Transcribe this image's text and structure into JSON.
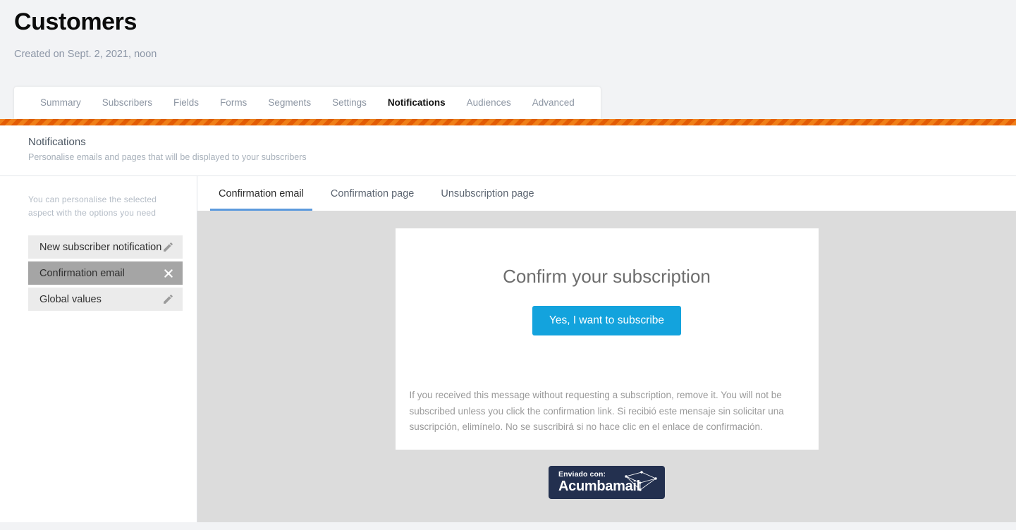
{
  "page": {
    "title": "Customers",
    "created": "Created on Sept. 2, 2021, noon"
  },
  "main_tabs": [
    {
      "label": "Summary",
      "active": false
    },
    {
      "label": "Subscribers",
      "active": false
    },
    {
      "label": "Fields",
      "active": false
    },
    {
      "label": "Forms",
      "active": false
    },
    {
      "label": "Segments",
      "active": false
    },
    {
      "label": "Settings",
      "active": false
    },
    {
      "label": "Notifications",
      "active": true
    },
    {
      "label": "Audiences",
      "active": false
    },
    {
      "label": "Advanced",
      "active": false
    }
  ],
  "section": {
    "title": "Notifications",
    "subtitle": "Personalise emails and pages that will be displayed to your subscribers"
  },
  "sidebar": {
    "hint": "You can personalise the selected aspect with the options you need",
    "items": [
      {
        "label": "New subscriber notification",
        "icon": "pencil-icon",
        "selected": false
      },
      {
        "label": "Confirmation email",
        "icon": "close-icon",
        "selected": true
      },
      {
        "label": "Global values",
        "icon": "pencil-icon",
        "selected": false
      }
    ]
  },
  "sub_tabs": [
    {
      "label": "Confirmation email",
      "active": true
    },
    {
      "label": "Confirmation page",
      "active": false
    },
    {
      "label": "Unsubscription page",
      "active": false
    }
  ],
  "email_preview": {
    "heading": "Confirm your subscription",
    "button_label": "Yes, I want to subscribe",
    "note": "If you received this message without requesting a subscription, remove it. You will not be subscribed unless you click the confirmation link. Si recibió este mensaje sin solicitar una suscripción, elimínelo. No se suscribirá si no hace clic en el enlace de confirmación.",
    "badge_top": "Enviado con:",
    "badge_name": "Acumbamail"
  },
  "colors": {
    "accent_orange": "#ee7000",
    "accent_blue": "#5c9add",
    "button_blue": "#13a3dd",
    "badge_navy": "#23304f",
    "page_bg": "#f2f3f5",
    "preview_bg": "#dcdcdc",
    "selected_item": "#a5a5a5"
  }
}
